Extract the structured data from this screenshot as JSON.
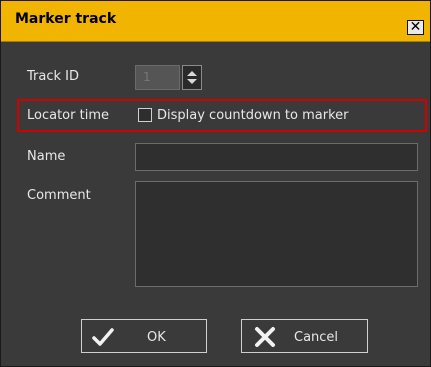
{
  "dialog": {
    "title": "Marker track",
    "close_glyph": "✕"
  },
  "track_id": {
    "label": "Track ID",
    "value": "1"
  },
  "locator_time": {
    "label": "Locator time",
    "checkbox_label": "Display countdown to marker",
    "checked": false
  },
  "name": {
    "label": "Name",
    "value": ""
  },
  "comment": {
    "label": "Comment",
    "value": ""
  },
  "buttons": {
    "ok_label": "OK",
    "cancel_label": "Cancel"
  },
  "icons": {
    "ok": "checkmark-icon",
    "cancel": "x-icon",
    "spin_up": "arrow-up-icon",
    "spin_down": "arrow-down-icon"
  },
  "colors": {
    "titlebar": "#f1b400",
    "panel": "#3a3a3a",
    "highlight_border": "#d30000"
  }
}
